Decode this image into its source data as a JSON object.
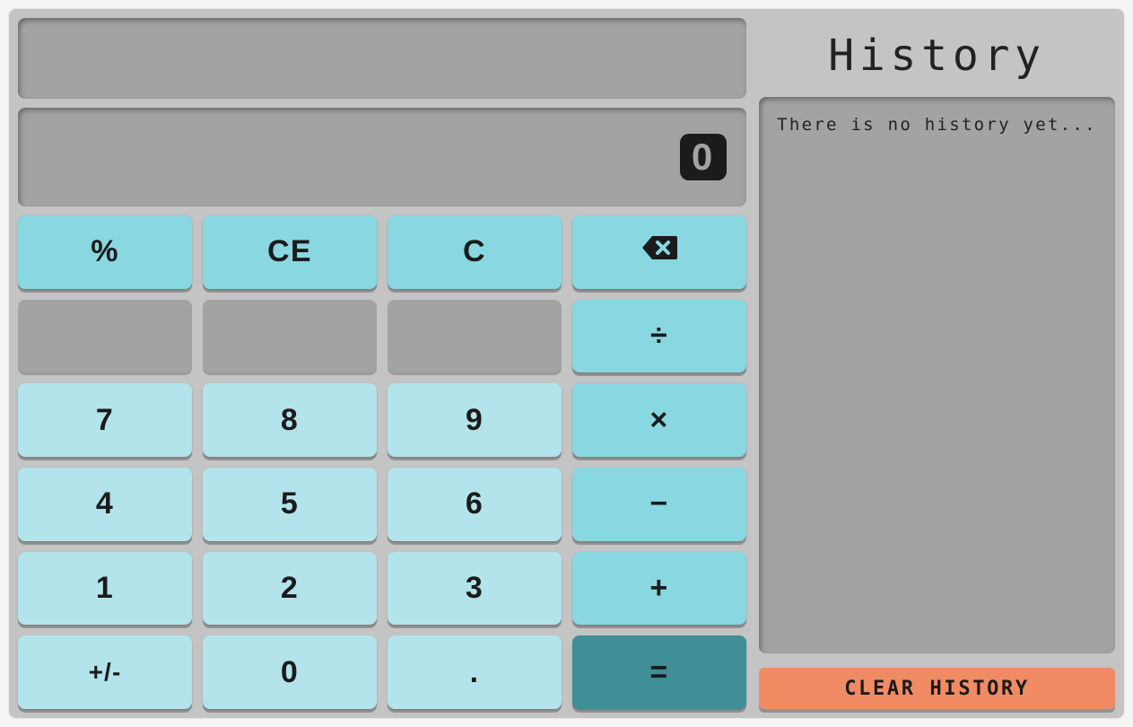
{
  "display": {
    "expression": "",
    "value": "0"
  },
  "keypad": {
    "row0": {
      "percent": "%",
      "ce": "CE",
      "c": "C",
      "backspace_icon": "backspace-icon"
    },
    "row1": {
      "blank0": "",
      "blank1": "",
      "blank2": "",
      "divide": "÷"
    },
    "row2": {
      "n7": "7",
      "n8": "8",
      "n9": "9",
      "multiply": "×"
    },
    "row3": {
      "n4": "4",
      "n5": "5",
      "n6": "6",
      "minus": "−"
    },
    "row4": {
      "n1": "1",
      "n2": "2",
      "n3": "3",
      "plus": "+"
    },
    "row5": {
      "negate": "+/-",
      "n0": "0",
      "dot": ".",
      "equals": "="
    }
  },
  "history": {
    "title": "History",
    "empty_text": "There is no history yet...",
    "clear_label": "CLEAR HISTORY",
    "items": []
  },
  "colors": {
    "panel": "#c4c4c4",
    "display": "#a3a3a3",
    "func_btn": "#89d7e0",
    "num_btn": "#b3e3eb",
    "equals_btn": "#3f8e96",
    "clear_history_btn": "#f08b64"
  }
}
